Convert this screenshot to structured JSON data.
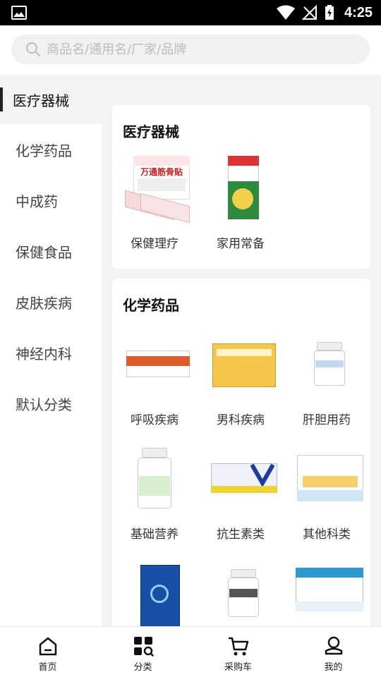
{
  "status_bar": {
    "time": "4:25"
  },
  "search": {
    "placeholder": "商品名/通用名/厂家/品牌"
  },
  "sidebar": {
    "items": [
      {
        "label": "医疗器械",
        "active": true
      },
      {
        "label": "化学药品"
      },
      {
        "label": "中成药"
      },
      {
        "label": "保健食品"
      },
      {
        "label": "皮肤疾病"
      },
      {
        "label": "神经内科"
      },
      {
        "label": "默认分类"
      }
    ]
  },
  "sections": [
    {
      "title": "医疗器械",
      "products": [
        {
          "label": "保健理疗",
          "image_text": "万通筋骨贴"
        },
        {
          "label": "家用常备",
          "image_text": ""
        }
      ]
    },
    {
      "title": "化学药品",
      "products": [
        {
          "label": "呼吸疾病"
        },
        {
          "label": "男科疾病"
        },
        {
          "label": "肝胆用药"
        },
        {
          "label": "基础营养"
        },
        {
          "label": "抗生素类"
        },
        {
          "label": "其他科类"
        },
        {
          "label": ""
        },
        {
          "label": ""
        },
        {
          "label": ""
        }
      ]
    }
  ],
  "bottom_nav": {
    "items": [
      {
        "label": "首页",
        "icon": "home-icon"
      },
      {
        "label": "分类",
        "icon": "category-icon"
      },
      {
        "label": "采购车",
        "icon": "cart-icon"
      },
      {
        "label": "我的",
        "icon": "profile-icon"
      }
    ]
  },
  "colors": {
    "accent": "#222222",
    "background": "#f3f3f3",
    "card": "#ffffff",
    "placeholder": "#bcbcbc"
  }
}
